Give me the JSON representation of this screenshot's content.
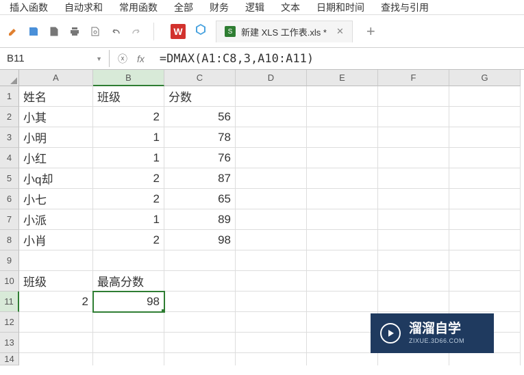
{
  "menu": [
    "插入函数",
    "自动求和",
    "常用函数",
    "全部",
    "财务",
    "逻辑",
    "文本",
    "日期和时间",
    "查找与引用"
  ],
  "tab": {
    "label": "新建 XLS 工作表.xls *"
  },
  "namebox": "B11",
  "formula": "=DMAX(A1:C8,3,A10:A11)",
  "cols": [
    "A",
    "B",
    "C",
    "D",
    "E",
    "F",
    "G"
  ],
  "rows": [
    "1",
    "2",
    "3",
    "4",
    "5",
    "6",
    "7",
    "8",
    "9",
    "10",
    "11",
    "12",
    "13",
    "14"
  ],
  "grid": {
    "A1": "姓名",
    "B1": "班级",
    "C1": "分数",
    "A2": "小其",
    "B2": "2",
    "C2": "56",
    "A3": "小明",
    "B3": "1",
    "C3": "78",
    "A4": "小红",
    "B4": "1",
    "C4": "76",
    "A5": "小q却",
    "B5": "2",
    "C5": "87",
    "A6": "小七",
    "B6": "2",
    "C6": "65",
    "A7": "小派",
    "B7": "1",
    "C7": "89",
    "A8": "小肖",
    "B8": "2",
    "C8": "98",
    "A10": "班级",
    "B10": "最高分数",
    "A11": "2",
    "B11": "98"
  },
  "watermark": {
    "title": "溜溜自学",
    "url": "ZIXUE.3D66.COM"
  },
  "chart_data": {
    "type": "table",
    "title": "",
    "columns": [
      "姓名",
      "班级",
      "分数"
    ],
    "rows": [
      [
        "小其",
        2,
        56
      ],
      [
        "小明",
        1,
        78
      ],
      [
        "小红",
        1,
        76
      ],
      [
        "小q却",
        2,
        87
      ],
      [
        "小七",
        2,
        65
      ],
      [
        "小派",
        1,
        89
      ],
      [
        "小肖",
        2,
        98
      ]
    ],
    "criteria": {
      "班级": 2
    },
    "result_label": "最高分数",
    "result_value": 98
  }
}
